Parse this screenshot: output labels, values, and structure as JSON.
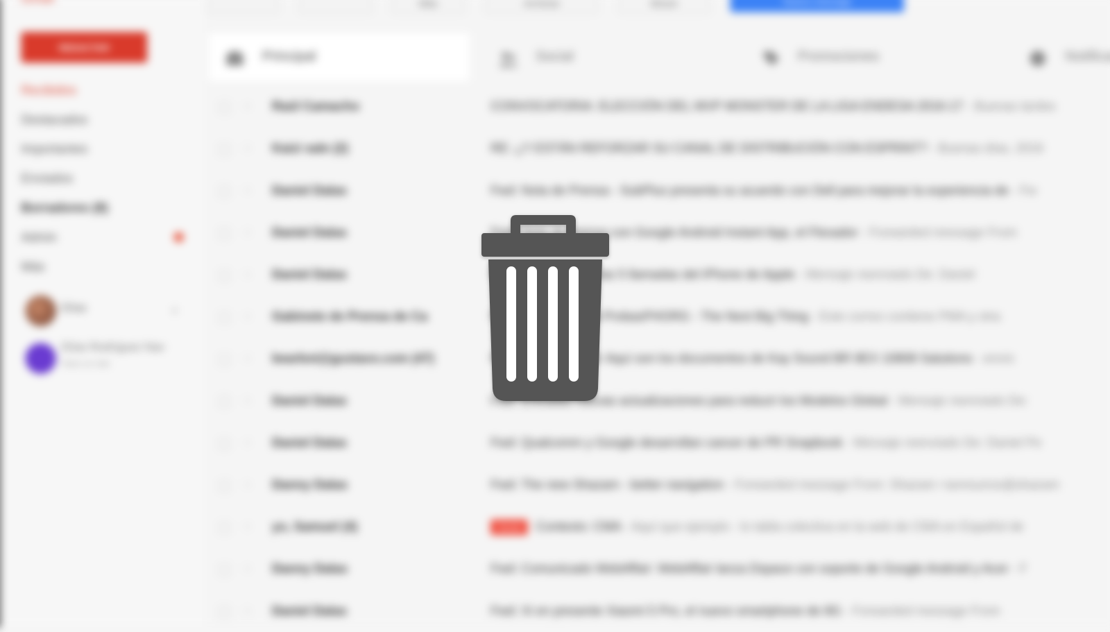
{
  "app": {
    "brand": "Gmail",
    "compose_label": "REDACTAR"
  },
  "sidebar": {
    "items": [
      {
        "label": "Recibidos"
      },
      {
        "label": "Destacados"
      },
      {
        "label": "Importantes"
      },
      {
        "label": "Enviados"
      },
      {
        "label": "Borradores (8)"
      },
      {
        "label": "Admin"
      },
      {
        "label": "Más"
      }
    ],
    "hangouts": [
      {
        "name": "Elías"
      },
      {
        "name": "Elías Rodríguez Nav",
        "sub": "Hace un rato"
      }
    ]
  },
  "toolbar": {
    "buttons": [
      "",
      "",
      "Más",
      "Archivar",
      "Mover",
      "Nuevo mensaje"
    ]
  },
  "tabs": [
    {
      "label": "Principal"
    },
    {
      "label": "Social"
    },
    {
      "label": "Promociones"
    },
    {
      "label": "Notificaciones"
    }
  ],
  "emails": [
    {
      "sender": "Raúl Camacho",
      "subject": "CONVOCATORIA: ELECCIÓN DEL MVP MONSTER DE LA LIGA ENDESA 2016-17",
      "snippet": " - Buenas tardes"
    },
    {
      "sender": "Kaizi sale (2)",
      "subject": "RE: ¿Y ESTÁN REFORZAR SU CANAL DE DISTRIBUCIÓN CON ESPRINT?",
      "snippet": " - Buenas días, 2016"
    },
    {
      "sender": "Daniel Dalas",
      "subject": "Fwd: Nota de Prensa - SubPlus presenta su acuerdo con Dell para mejorar la experiencia de",
      "snippet": " - Fw"
    },
    {
      "sender": "Daniel Dalas",
      "subject": "Fwd: Nota de prensa con Google Android Instant App, el Flexador",
      "snippet": " - Forwarded message From"
    },
    {
      "sender": "Daniel Dalas",
      "subject": "Fwd: Novedades y las 5 llamadas del iPhone de Apple",
      "snippet": " - Mensaje reenviado De: Daniel"
    },
    {
      "sender": "Gabinete de Prensa de Ca",
      "subject": "Fwd: Dafit presenta ProbasPHORG - The Next Big Thing",
      "snippet": " - Este correo contiene PMA y otra"
    },
    {
      "sender": "bearbot@gustavo.com (47)",
      "subject": "Fwd: Kay Sociedad: Aquí son los documentos de Kay Sound BR 8EX 10808 Salutions",
      "snippet": " - envío"
    },
    {
      "sender": "Daniel Dalas",
      "subject": "Fwd: Entradas nuevas actualizaciones para reducir los Modelos Global",
      "snippet": " - Mensaje reenviado De:"
    },
    {
      "sender": "Daniel Dalas",
      "subject": "Fwd: Qualcomm y Google desarrollan cancer de PR Snapbook",
      "snippet": " - Mensaje reenviado De: Daniel Pe"
    },
    {
      "sender": "Danny Dalas",
      "subject": "Fwd: The new Shazam - better navigation",
      "snippet": " - Forwarded message From: Shazam <announce@shazam"
    },
    {
      "sender": "yo, Samuel (4)",
      "tag": "Social",
      "subject": "Contexto: CMA",
      "snippet": " - Aquí que ejemplo - lo tabla colectiva en la web de CMA en Español de"
    },
    {
      "sender": "Danny Dalas",
      "subject": "Fwd: Comunicado WebAffair: WebAffair lanza Dspace con soporte de Google Android y Acer",
      "snippet": " - F"
    },
    {
      "sender": "Daniel Dalas",
      "subject": "Fwd: Xi en presente Xiaomi 5 Pro, el nuevo smartphone de 8G",
      "snippet": " - Forwarded message From"
    }
  ],
  "overlay": {
    "icon": "trash-icon",
    "color": "#555555"
  }
}
